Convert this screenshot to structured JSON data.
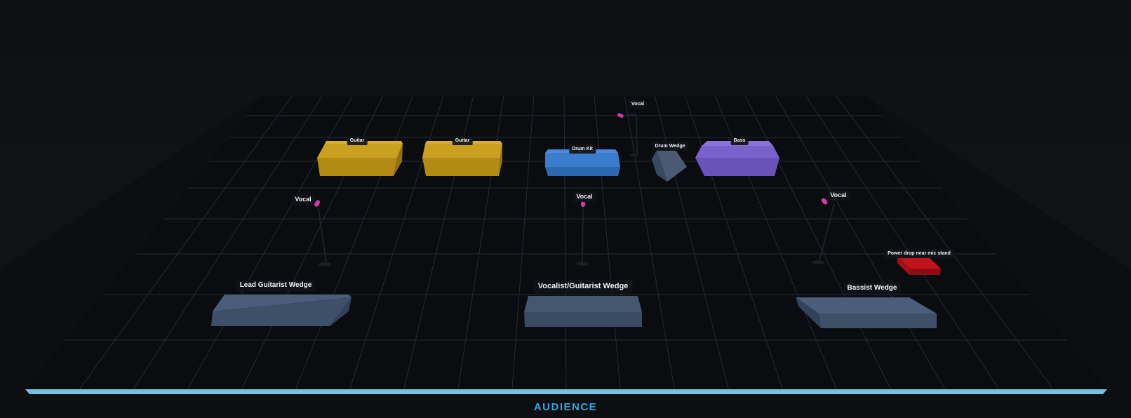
{
  "stage": {
    "audience_label": "AUDIENCE",
    "colors": {
      "background": "#0f1114",
      "floor": "#0a0c0f",
      "grid": "#2a2f37",
      "audience_edge": "#6fc4dd",
      "guitar_amp": "#c9a020",
      "drum_kit": "#3a7dcc",
      "bass_amp": "#7a62cc",
      "wedge": "#3e4f68",
      "power_drop": "#c2121c",
      "microphone": "#d13aa8"
    }
  },
  "items": {
    "guitar_amp_left": {
      "label": "Guitar",
      "type": "amp",
      "icon": "guitar-amp-icon"
    },
    "guitar_amp_right": {
      "label": "Guitar",
      "type": "amp",
      "icon": "guitar-amp-icon"
    },
    "drum_kit": {
      "label": "Drum Kit",
      "type": "drum",
      "icon": "drum-icon"
    },
    "drum_mic": {
      "label": "Vocal",
      "type": "mic",
      "icon": "microphone-icon"
    },
    "drum_wedge": {
      "label": "Drum Wedge",
      "type": "wedge",
      "icon": "monitor-wedge-icon"
    },
    "bass_amp": {
      "label": "Bass",
      "type": "amp",
      "icon": "bass-amp-icon"
    },
    "vocal_mic_left": {
      "label": "Vocal",
      "type": "mic",
      "icon": "microphone-icon"
    },
    "vocal_mic_center": {
      "label": "Vocal",
      "type": "mic",
      "icon": "microphone-icon"
    },
    "vocal_mic_right": {
      "label": "Vocal",
      "type": "mic",
      "icon": "microphone-icon"
    },
    "power_drop": {
      "label": "Power drop near mic stand",
      "type": "power",
      "icon": "power-drop-icon"
    },
    "lead_guitarist_wedge": {
      "label": "Lead Guitarist Wedge",
      "type": "wedge",
      "icon": "monitor-wedge-icon"
    },
    "vocalist_guitarist_wedge": {
      "label": "Vocalist/Guitarist Wedge",
      "type": "wedge",
      "icon": "monitor-wedge-icon"
    },
    "bassist_wedge": {
      "label": "Bassist Wedge",
      "type": "wedge",
      "icon": "monitor-wedge-icon"
    }
  }
}
